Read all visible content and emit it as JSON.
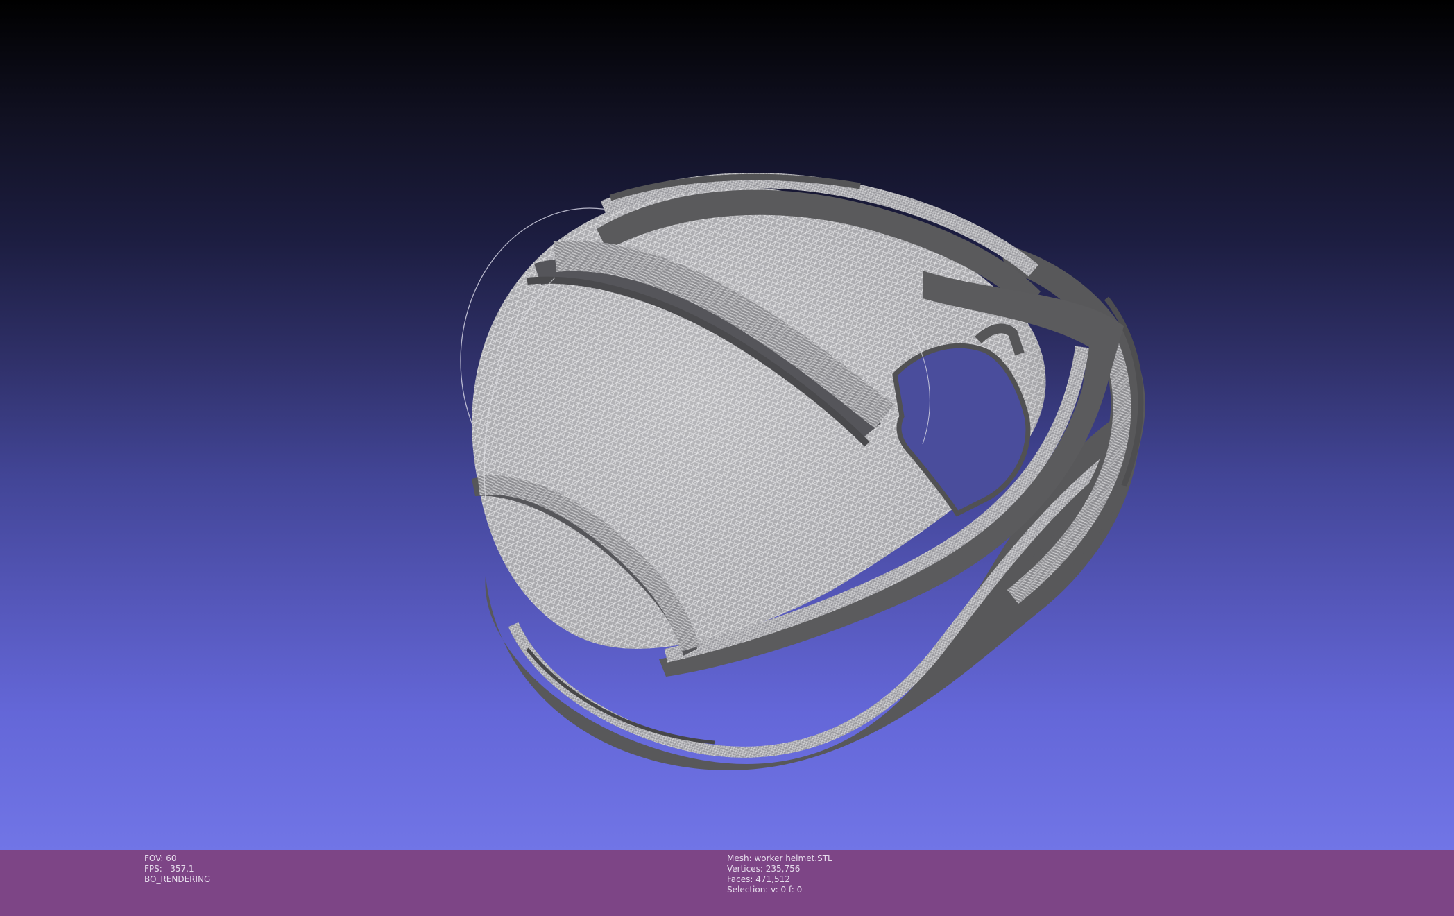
{
  "viewport": {
    "background_top": "#000000",
    "background_bottom": "#7175e6",
    "mesh_color": "#5a5a5c",
    "wire_color": "#d8d8d8",
    "trackball_color": "#d0d0e0"
  },
  "status_left": {
    "fov": "FOV: 60",
    "fps": "FPS:   357.1",
    "mode": "BO_RENDERING"
  },
  "status_right": {
    "mesh": "Mesh: worker helmet.STL",
    "vertices": "Vertices: 235,756",
    "faces": "Faces: 471,512",
    "selection": "Selection: v: 0 f: 0"
  },
  "info_bar": {
    "color": "#7d4586"
  }
}
